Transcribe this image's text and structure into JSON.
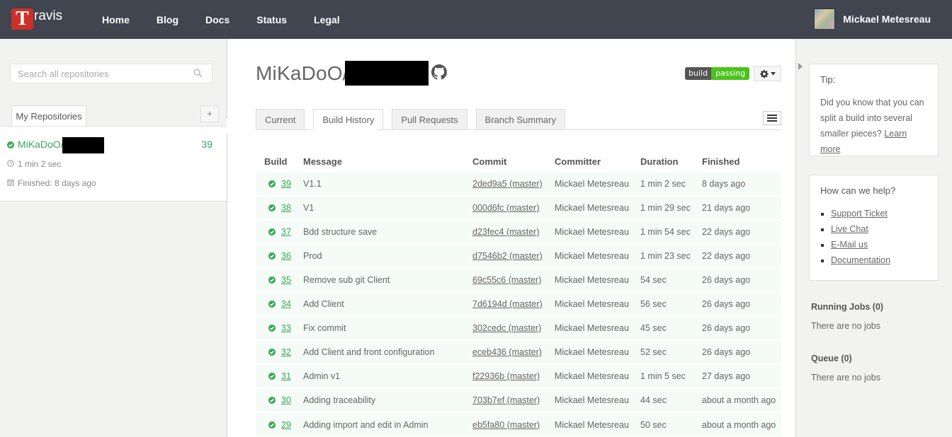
{
  "header": {
    "logo_letter": "T",
    "logo_text": "ravis",
    "nav": [
      "Home",
      "Blog",
      "Docs",
      "Status",
      "Legal"
    ],
    "user_name": "Mickael Metesreau"
  },
  "sidebar": {
    "search_placeholder": "Search all repositories",
    "tab_label": "My Repositories",
    "add_label": "+",
    "repo": {
      "name": "MiKaDoO/",
      "number": "39",
      "duration": "1 min 2 sec",
      "finished": "Finished: 8 days ago"
    }
  },
  "main": {
    "repo_title": "MiKaDoO/",
    "badge": {
      "left": "build",
      "right": "passing"
    },
    "tabs": [
      "Current",
      "Build History",
      "Pull Requests",
      "Branch Summary"
    ],
    "active_tab": "Build History",
    "columns": [
      "Build",
      "Message",
      "Commit",
      "Committer",
      "Duration",
      "Finished"
    ],
    "builds": [
      {
        "num": "39",
        "message": "V1.1",
        "commit": "2ded9a5 (master)",
        "committer": "Mickael Metesreau",
        "duration": "1 min 2 sec",
        "finished": "8 days ago"
      },
      {
        "num": "38",
        "message": "V1",
        "commit": "000d6fc (master)",
        "committer": "Mickael Metesreau",
        "duration": "1 min 29 sec",
        "finished": "21 days ago"
      },
      {
        "num": "37",
        "message": "Bdd structure save",
        "commit": "d23fec4 (master)",
        "committer": "Mickael Metesreau",
        "duration": "1 min 54 sec",
        "finished": "22 days ago"
      },
      {
        "num": "36",
        "message": "Prod",
        "commit": "d7546b2 (master)",
        "committer": "Mickael Metesreau",
        "duration": "1 min 23 sec",
        "finished": "22 days ago"
      },
      {
        "num": "35",
        "message": "Remove sub git Client",
        "commit": "69c55c6 (master)",
        "committer": "Mickael Metesreau",
        "duration": "54 sec",
        "finished": "26 days ago"
      },
      {
        "num": "34",
        "message": "Add Client",
        "commit": "7d6194d (master)",
        "committer": "Mickael Metesreau",
        "duration": "56 sec",
        "finished": "26 days ago"
      },
      {
        "num": "33",
        "message": "Fix commit",
        "commit": "302cedc (master)",
        "committer": "Mickael Metesreau",
        "duration": "45 sec",
        "finished": "26 days ago"
      },
      {
        "num": "32",
        "message": "Add Client and front configuration",
        "commit": "eceb436 (master)",
        "committer": "Mickael Metesreau",
        "duration": "52 sec",
        "finished": "26 days ago"
      },
      {
        "num": "31",
        "message": "Admin v1",
        "commit": "f22936b (master)",
        "committer": "Mickael Metesreau",
        "duration": "1 min 5 sec",
        "finished": "27 days ago"
      },
      {
        "num": "30",
        "message": "Adding traceability",
        "commit": "703b7ef (master)",
        "committer": "Mickael Metesreau",
        "duration": "44 sec",
        "finished": "about a month ago"
      },
      {
        "num": "29",
        "message": "Adding import and edit in Admin",
        "commit": "eb5fa80 (master)",
        "committer": "Mickael Metesreau",
        "duration": "50 sec",
        "finished": "about a month ago"
      }
    ]
  },
  "right": {
    "tip_title": "Tip:",
    "tip_text": "Did you know that you can split a build into several smaller pieces?",
    "tip_link": "Learn more",
    "help_title": "How can we help?",
    "help_links": [
      "Support Ticket",
      "Live Chat",
      "E-Mail us",
      "Documentation"
    ],
    "running_title": "Running Jobs (0)",
    "running_text": "There are no jobs",
    "queue_title": "Queue (0)",
    "queue_text": "There are no jobs"
  },
  "colors": {
    "topbar": "#40454f",
    "passing": "#39a85b",
    "logo": "#cd3029",
    "badge_pass": "#4ac41c"
  },
  "icons": [
    "search-icon",
    "check-circle-icon",
    "clock-icon",
    "calendar-icon",
    "github-icon",
    "gear-icon",
    "chevron-down-icon",
    "menu-icon"
  ]
}
